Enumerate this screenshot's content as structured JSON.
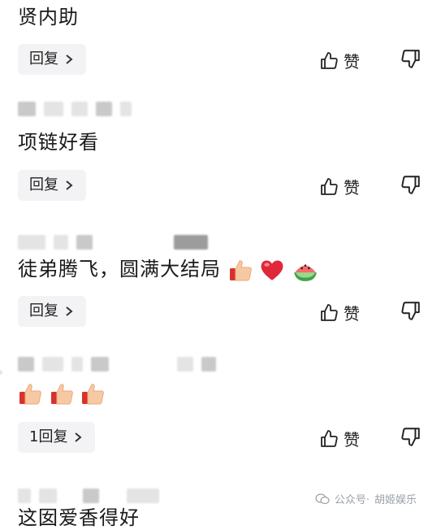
{
  "comments": [
    {
      "text": "贤内助",
      "reply_label": "回复",
      "like_label": "赞"
    },
    {
      "text": "项链好看",
      "reply_label": "回复",
      "like_label": "赞"
    },
    {
      "text": "徒弟腾飞，圆满大结局",
      "reply_label": "回复",
      "like_label": "赞",
      "emojis": [
        "thumbs-up",
        "red-heart",
        "watermelon"
      ]
    },
    {
      "text": "",
      "reply_label": "1回复",
      "like_label": "赞",
      "emojis": [
        "thumbs-up",
        "thumbs-up",
        "thumbs-up"
      ]
    },
    {
      "text": "这囡爱香得好"
    }
  ],
  "watermark": {
    "label": "公众号·",
    "name": "胡姬娱乐"
  },
  "icons": {
    "like": "thumbs-up-outline-icon",
    "dislike": "thumbs-down-outline-icon",
    "reply_arrow": "chevron-right-icon",
    "watermark_logo": "wechat-icon"
  },
  "colors": {
    "reply_bg": "#f3f3f5",
    "text": "#1a1a1a",
    "muted": "#9aa0a6"
  }
}
